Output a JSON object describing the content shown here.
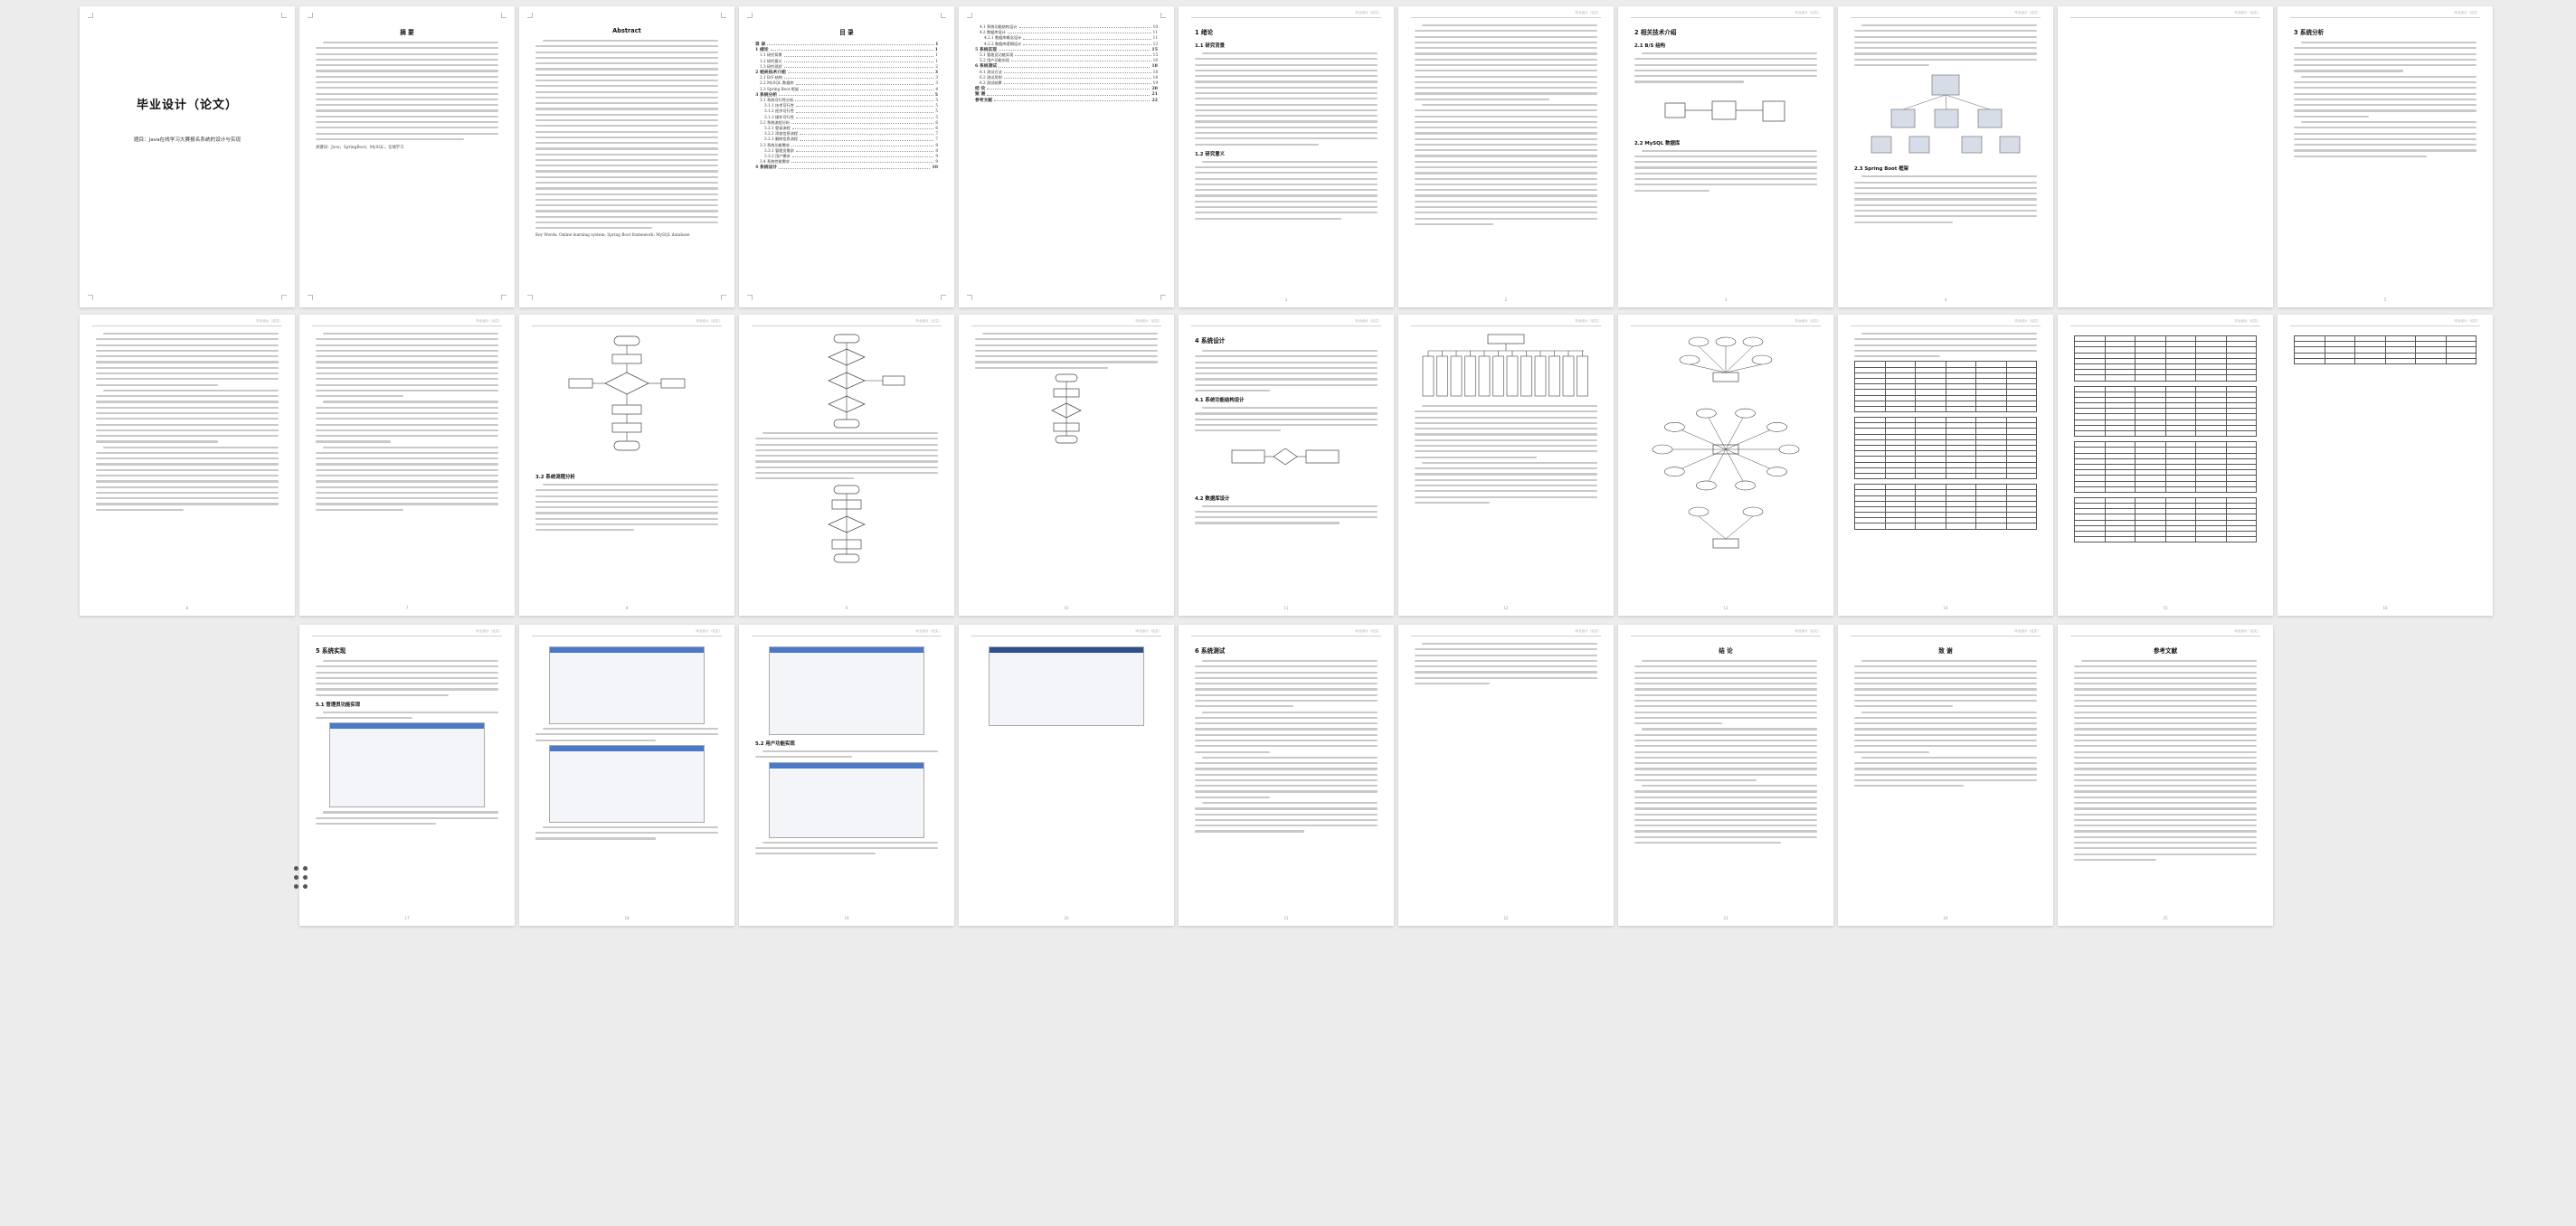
{
  "document": {
    "header_text": "毕业设计（论文）",
    "cover": {
      "title": "毕业设计（论文）",
      "subtitle": "题目：Java在线学习大赛报名系统的设计与实现"
    },
    "abstract_cn": {
      "title": "摘 要",
      "keywords": "关键词：Java；SpringBoot；MySQL；在线学习"
    },
    "abstract_en": {
      "title": "Abstract",
      "keywords": "Key Words: Online learning system; Spring Boot framework; MySQL database"
    },
    "toc": {
      "title": "目 录",
      "entries": [
        {
          "label": "目 录",
          "page": "I",
          "bold": true
        },
        {
          "label": "1 绪论",
          "page": "1",
          "bold": true
        },
        {
          "label": "1.1 研究背景",
          "page": "1",
          "bold": false
        },
        {
          "label": "1.2 研究意义",
          "page": "1",
          "bold": false
        },
        {
          "label": "1.3 研究现状",
          "page": "2",
          "bold": false
        },
        {
          "label": "2 相关技术介绍",
          "page": "3",
          "bold": true
        },
        {
          "label": "2.1 B/S 结构",
          "page": "3",
          "bold": false
        },
        {
          "label": "2.2 MySQL 数据库",
          "page": "3",
          "bold": false
        },
        {
          "label": "2.3 Spring Boot 框架",
          "page": "4",
          "bold": false
        },
        {
          "label": "3 系统分析",
          "page": "5",
          "bold": true
        },
        {
          "label": "3.1 系统可行性分析",
          "page": "5",
          "bold": false
        },
        {
          "label": "3.1.1 技术可行性",
          "page": "5",
          "bold": false
        },
        {
          "label": "3.1.2 经济可行性",
          "page": "5",
          "bold": false
        },
        {
          "label": "3.1.3 操作可行性",
          "page": "5",
          "bold": false
        },
        {
          "label": "3.2 系统流程分析",
          "page": "6",
          "bold": false
        },
        {
          "label": "3.2.1 登录流程",
          "page": "6",
          "bold": false
        },
        {
          "label": "3.2.2 添加信息流程",
          "page": "7",
          "bold": false
        },
        {
          "label": "3.2.3 删除信息流程",
          "page": "7",
          "bold": false
        },
        {
          "label": "3.3 系统功能需求",
          "page": "8",
          "bold": false
        },
        {
          "label": "3.3.1 管理员需求",
          "page": "8",
          "bold": false
        },
        {
          "label": "3.3.2 用户需求",
          "page": "9",
          "bold": false
        },
        {
          "label": "3.4 系统性能需求",
          "page": "9",
          "bold": false
        },
        {
          "label": "4 系统设计",
          "page": "10",
          "bold": true
        }
      ],
      "entries_p2": [
        {
          "label": "4.1 系统功能结构设计",
          "page": "10",
          "bold": false
        },
        {
          "label": "4.2 数据库设计",
          "page": "11",
          "bold": false
        },
        {
          "label": "4.2.1 数据库概念设计",
          "page": "11",
          "bold": false
        },
        {
          "label": "4.2.2 数据库逻辑设计",
          "page": "12",
          "bold": false
        },
        {
          "label": "5 系统实现",
          "page": "15",
          "bold": true
        },
        {
          "label": "5.1 管理员功能实现",
          "page": "15",
          "bold": false
        },
        {
          "label": "5.2 用户功能实现",
          "page": "16",
          "bold": false
        },
        {
          "label": "6 系统测试",
          "page": "18",
          "bold": true
        },
        {
          "label": "6.1 测试方法",
          "page": "18",
          "bold": false
        },
        {
          "label": "6.2 测试用例",
          "page": "18",
          "bold": false
        },
        {
          "label": "6.3 测试结果",
          "page": "19",
          "bold": false
        },
        {
          "label": "结 论",
          "page": "20",
          "bold": true
        },
        {
          "label": "致 谢",
          "page": "21",
          "bold": true
        },
        {
          "label": "参考文献",
          "page": "22",
          "bold": true
        }
      ]
    },
    "sections": {
      "ch1": "1 绪论",
      "ch1_1": "1.1 研究背景",
      "ch1_2": "1.2 研究意义",
      "ch2": "2 相关技术介绍",
      "ch2_1": "2.1 B/S 结构",
      "ch2_2": "2.2 MySQL 数据库",
      "ch2_3": "2.3 Spring Boot 框架",
      "ch3": "3 系统分析",
      "ch3_2": "3.2 系统流程分析",
      "ch4": "4 系统设计",
      "ch4_1": "4.1 系统功能结构设计",
      "ch4_2": "4.2 数据库设计",
      "ch5": "5 系统实现",
      "ch5_1": "5.1 管理员功能实现",
      "ch5_2": "5.2 用户功能实现",
      "ch6": "6 系统测试",
      "conclusion": "结 论",
      "thanks": "致 谢",
      "references": "参考文献"
    }
  }
}
